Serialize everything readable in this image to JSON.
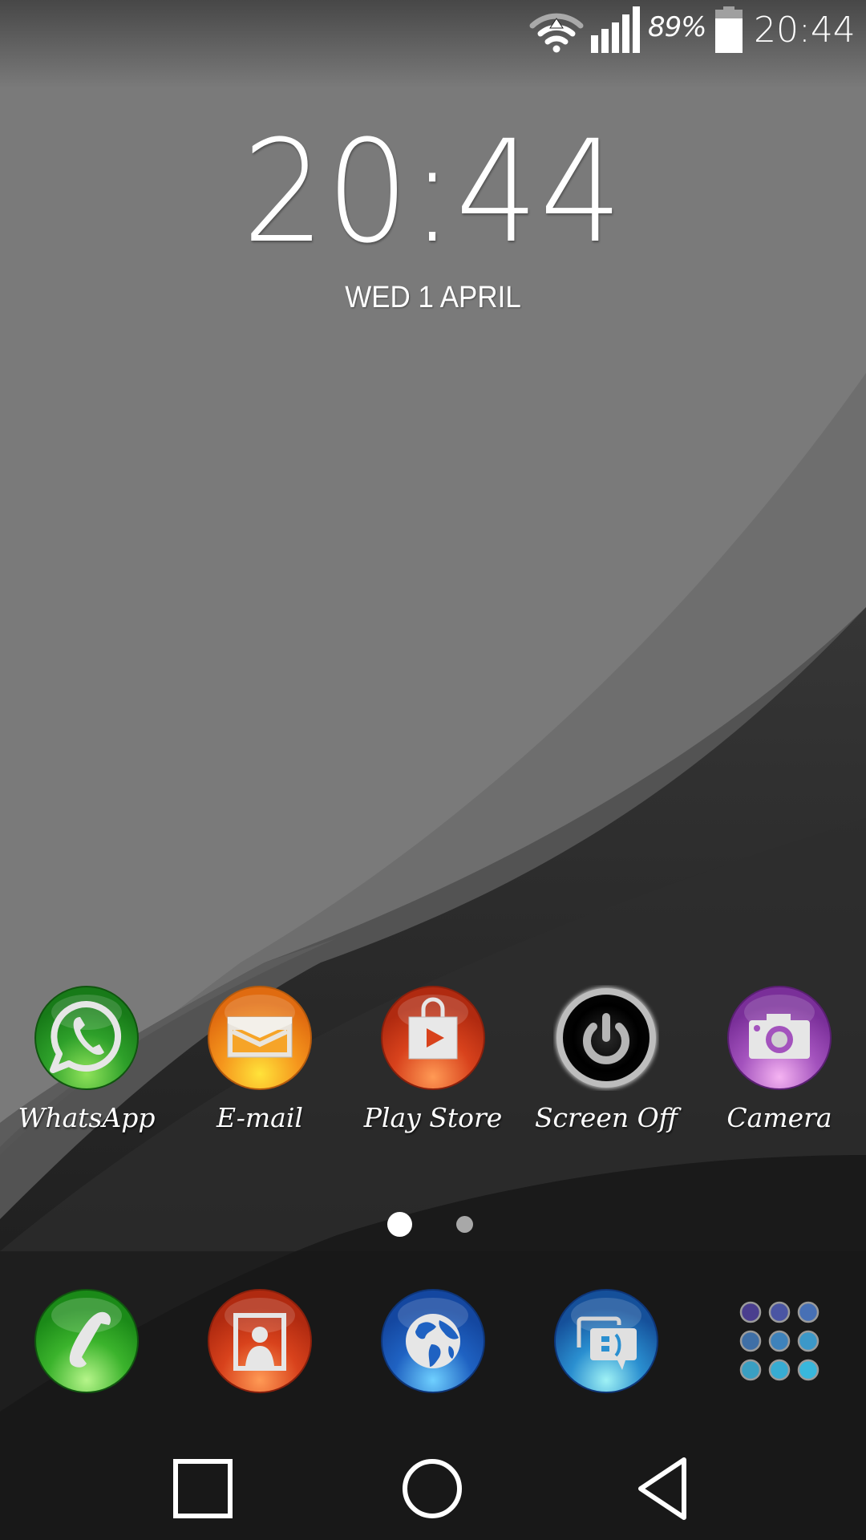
{
  "status_bar": {
    "wifi_icon": "wifi-icon",
    "signal_icon": "cellular-signal-icon",
    "battery_percent": "89%",
    "battery_icon": "battery-icon",
    "battery_level": 0.89,
    "time": "20:44"
  },
  "lockclock": {
    "time": "20:44",
    "date": "WED 1 APRIL"
  },
  "home_apps": [
    {
      "label": "WhatsApp",
      "icon": "whatsapp-icon",
      "color": "#2ea02a"
    },
    {
      "label": "E-mail",
      "icon": "email-icon",
      "color": "#f2891c"
    },
    {
      "label": "Play Store",
      "icon": "play-store-icon",
      "color": "#d8421c"
    },
    {
      "label": "Screen Off",
      "icon": "power-icon",
      "color": "#000000"
    },
    {
      "label": "Camera",
      "icon": "camera-icon",
      "color": "#9b4fb5"
    }
  ],
  "page_indicator": {
    "pages": 2,
    "current": 1
  },
  "dock": [
    {
      "name": "phone",
      "icon": "phone-icon",
      "color": "#2a9d22"
    },
    {
      "name": "contacts",
      "icon": "contacts-icon",
      "color": "#d13f1a"
    },
    {
      "name": "browser",
      "icon": "globe-icon",
      "color": "#1f5fb8"
    },
    {
      "name": "messaging",
      "icon": "messaging-icon",
      "color": "#1e6fb8"
    },
    {
      "name": "app drawer",
      "icon": "app-drawer-icon",
      "color": "#3f86c4"
    }
  ],
  "nav_bar": {
    "recents": "recents-icon",
    "home": "home-icon",
    "back": "back-icon"
  }
}
